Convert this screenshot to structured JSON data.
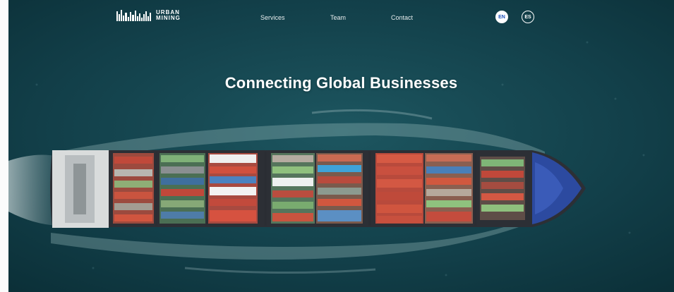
{
  "brand": {
    "line1": "URBAN",
    "line2": "MINING",
    "logo_icon": "city-skyline-icon"
  },
  "nav": {
    "services": "Services",
    "team": "Team",
    "contact": "Contact"
  },
  "languages": {
    "en": "EN",
    "es": "ES",
    "active": "EN"
  },
  "hero": {
    "headline": "Connecting Global Businesses",
    "image": "container-ship-aerial"
  },
  "colors": {
    "ocean": "#0e3a44",
    "lang_active_text": "#1a4fb8",
    "hull": "#2c4aa0"
  }
}
